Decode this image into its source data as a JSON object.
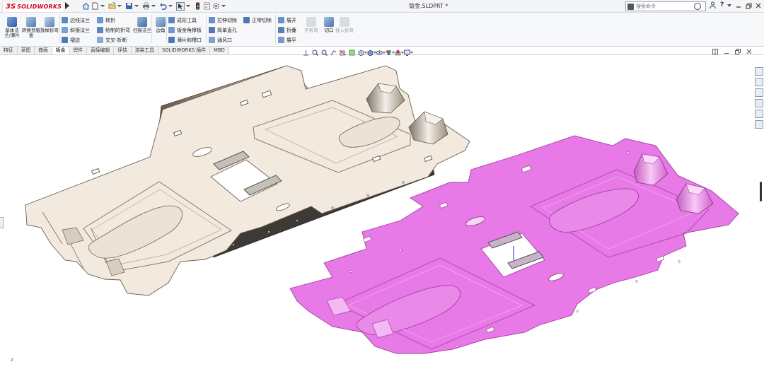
{
  "app": {
    "brand_ds": "3S",
    "brand_name": "SOLIDWORKS",
    "document_title": "钣金.SLDPRT *"
  },
  "search": {
    "placeholder": "搜索命令"
  },
  "titlebar_right": {
    "help": "?"
  },
  "ribbon": {
    "big_buttons": [
      {
        "label": "基体法兰/薄片",
        "enabled": true
      },
      {
        "label": "转换到钣金",
        "enabled": true
      },
      {
        "label": "放样折弯",
        "enabled": true
      },
      {
        "label": "扫描法兰",
        "enabled": true
      },
      {
        "label": "边角",
        "enabled": true
      },
      {
        "label": "不折弯",
        "enabled": false
      },
      {
        "label": "切口",
        "enabled": true
      },
      {
        "label": "插入折弯",
        "enabled": false
      }
    ],
    "small_buttons": {
      "edge_flange": "边线法兰",
      "miter_flange": "斜接法兰",
      "hem": "褶边",
      "jog": "转折",
      "sketched_bend": "绘制的折弯",
      "cross_break": "交叉-折断",
      "forming_tool": "成形工具",
      "gusset": "钣金角撑板",
      "tab_slot": "薄片和槽口",
      "extruded_cut": "拉伸切除",
      "simple_hole": "简单直孔",
      "vent": "通风口",
      "normal_cut": "正常切除",
      "unfold": "展开",
      "fold": "折叠",
      "flatten": "展平"
    }
  },
  "tabs": [
    {
      "label": "特征",
      "active": false
    },
    {
      "label": "草图",
      "active": false
    },
    {
      "label": "曲面",
      "active": false
    },
    {
      "label": "钣金",
      "active": true
    },
    {
      "label": "焊件",
      "active": false
    },
    {
      "label": "直接编辑",
      "active": false
    },
    {
      "label": "评估",
      "active": false
    },
    {
      "label": "渲染工具",
      "active": false
    },
    {
      "label": "SOLIDWORKS 插件",
      "active": false
    },
    {
      "label": "MBD",
      "active": false
    }
  ],
  "colors": {
    "part_left": "#f2eadf",
    "part_left_shadow": "#6d5d4f",
    "part_right": "#e77ae6",
    "part_right_edge": "#c34fc2",
    "brand_red": "#d0021b"
  },
  "triad_label": "z"
}
